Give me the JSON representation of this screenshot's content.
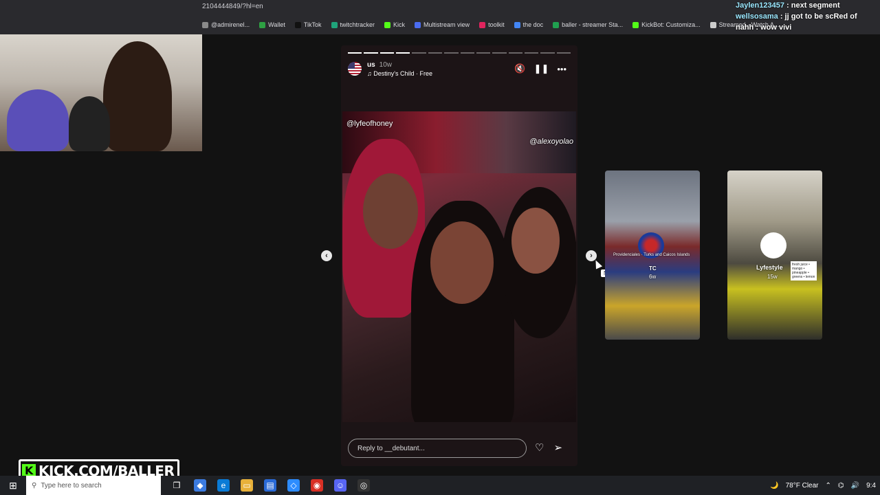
{
  "browser": {
    "url": "2104444849/?hl=en",
    "bookmarks": [
      {
        "label": "@admirenel...",
        "color": "#8a8a8a"
      },
      {
        "label": "Wallet",
        "color": "#2ea043"
      },
      {
        "label": "TikTok",
        "color": "#111111"
      },
      {
        "label": "twitchtracker",
        "color": "#1fa37a"
      },
      {
        "label": "Kick",
        "color": "#53fc18"
      },
      {
        "label": "Multistream view",
        "color": "#4a6cf0"
      },
      {
        "label": "toolkit",
        "color": "#e0245e"
      },
      {
        "label": "the doc",
        "color": "#4285f4"
      },
      {
        "label": "baller - streamer Sta...",
        "color": "#20a050"
      },
      {
        "label": "KickBot: Customiza...",
        "color": "#53fc18"
      },
      {
        "label": "Streamed - Watch A...",
        "color": "#cccccc"
      }
    ]
  },
  "chat": [
    {
      "user": "Jaylen123457",
      "message": "next segment"
    },
    {
      "user": "wellsosama",
      "message": "jj got to be scRed of"
    },
    {
      "user": "nahh",
      "message": "wow vivi"
    }
  ],
  "story": {
    "username": "us",
    "age": "10w",
    "song": "Destiny's Child · Free",
    "mute_icon": "mute-icon",
    "pause_icon": "pause-icon",
    "more_icon": "more-icon",
    "progress_total": 14,
    "progress_done": 4,
    "tag_left": "@lyfeofhoney",
    "tag_right": "@alexoyolao",
    "reply_placeholder": "Reply to __debutant...",
    "prev_glyph": "‹",
    "next_glyph": "›",
    "next_tooltip": "Next"
  },
  "side_stories": [
    {
      "label": "TC",
      "sub": "6w",
      "caption": "Providenciales · Turks and Caicos Islands"
    },
    {
      "label": "Lyfestyle",
      "sub": "15w",
      "caption": "fresh juice • mango • pineapple • greens • lemon"
    }
  ],
  "watermark": {
    "logo": "K",
    "text": "KICK.COM/BALLER"
  },
  "taskbar": {
    "search_placeholder": "Type here to search",
    "weather": "78°F  Clear",
    "time": "9:4"
  },
  "colors": {
    "kick_green": "#53fc18",
    "chat_user": "#9be8ff"
  }
}
